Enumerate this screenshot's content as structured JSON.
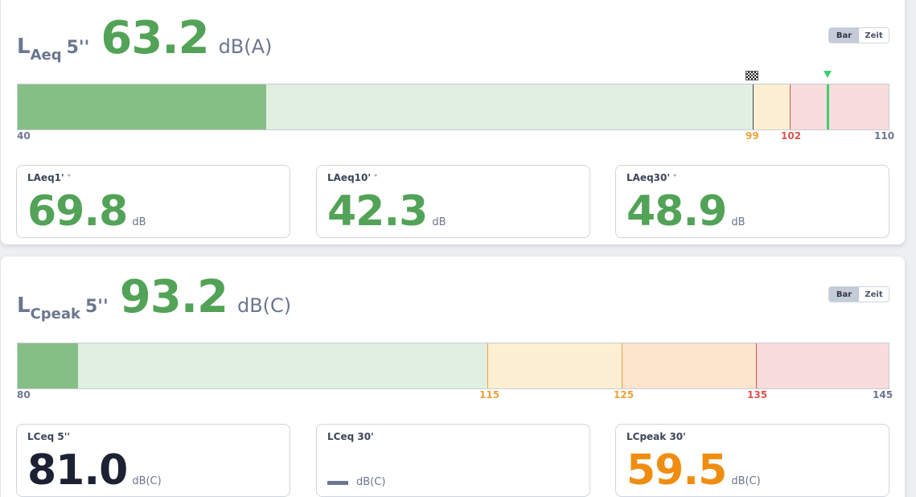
{
  "panel1": {
    "metric": {
      "main": "L",
      "sub": "Aeq",
      "suffix": "5''"
    },
    "value": "63.2",
    "unit": "dB(A)",
    "toggle": {
      "bar": "Bar",
      "zeit": "Zeit"
    },
    "meter": {
      "min": 40,
      "max": 110,
      "level": 60,
      "marker_value": 105.3,
      "ticks": {
        "min": "40",
        "t1": "99",
        "t2": "102",
        "max": "110"
      }
    },
    "stats": [
      {
        "label": "LAeq1'",
        "star": "*",
        "value": "69.8",
        "unit": "dB"
      },
      {
        "label": "LAeq10'",
        "star": "*",
        "value": "42.3",
        "unit": "dB"
      },
      {
        "label": "LAeq30'",
        "star": "*",
        "value": "48.9",
        "unit": "dB"
      }
    ]
  },
  "panel2": {
    "metric": {
      "main": "L",
      "sub": "Cpeak",
      "suffix": "5''"
    },
    "value": "93.2",
    "unit": "dB(C)",
    "toggle": {
      "bar": "Bar",
      "zeit": "Zeit"
    },
    "meter": {
      "min": 80,
      "max": 145,
      "level": 84.5,
      "ticks": {
        "min": "80",
        "t1": "115",
        "t2": "125",
        "t3": "135",
        "max": "145"
      }
    },
    "stats": [
      {
        "label": "LCeq 5''",
        "value": "81.0",
        "unit": "dB(C)"
      },
      {
        "label": "LCeq 30'",
        "value": "",
        "unit": "dB(C)"
      },
      {
        "label": "LCpeak 30'",
        "value": "59.5",
        "unit": "dB(C)"
      }
    ]
  },
  "colors": {
    "green": "#52a257",
    "dark": "#1c2233",
    "orange": "#ef8d12",
    "tick_warn": "#e8a33a",
    "tick_danger": "#d9534f",
    "zone_green_fill": "#86bf86",
    "zone_green_light": "#e1efe1",
    "zone_yellow": "#fdf0d2",
    "zone_orange": "#fde4cd",
    "zone_red": "#f9dcdc"
  },
  "icons": {
    "checkpoint": "checkered-flag-icon",
    "current": "triangle-down-icon"
  }
}
